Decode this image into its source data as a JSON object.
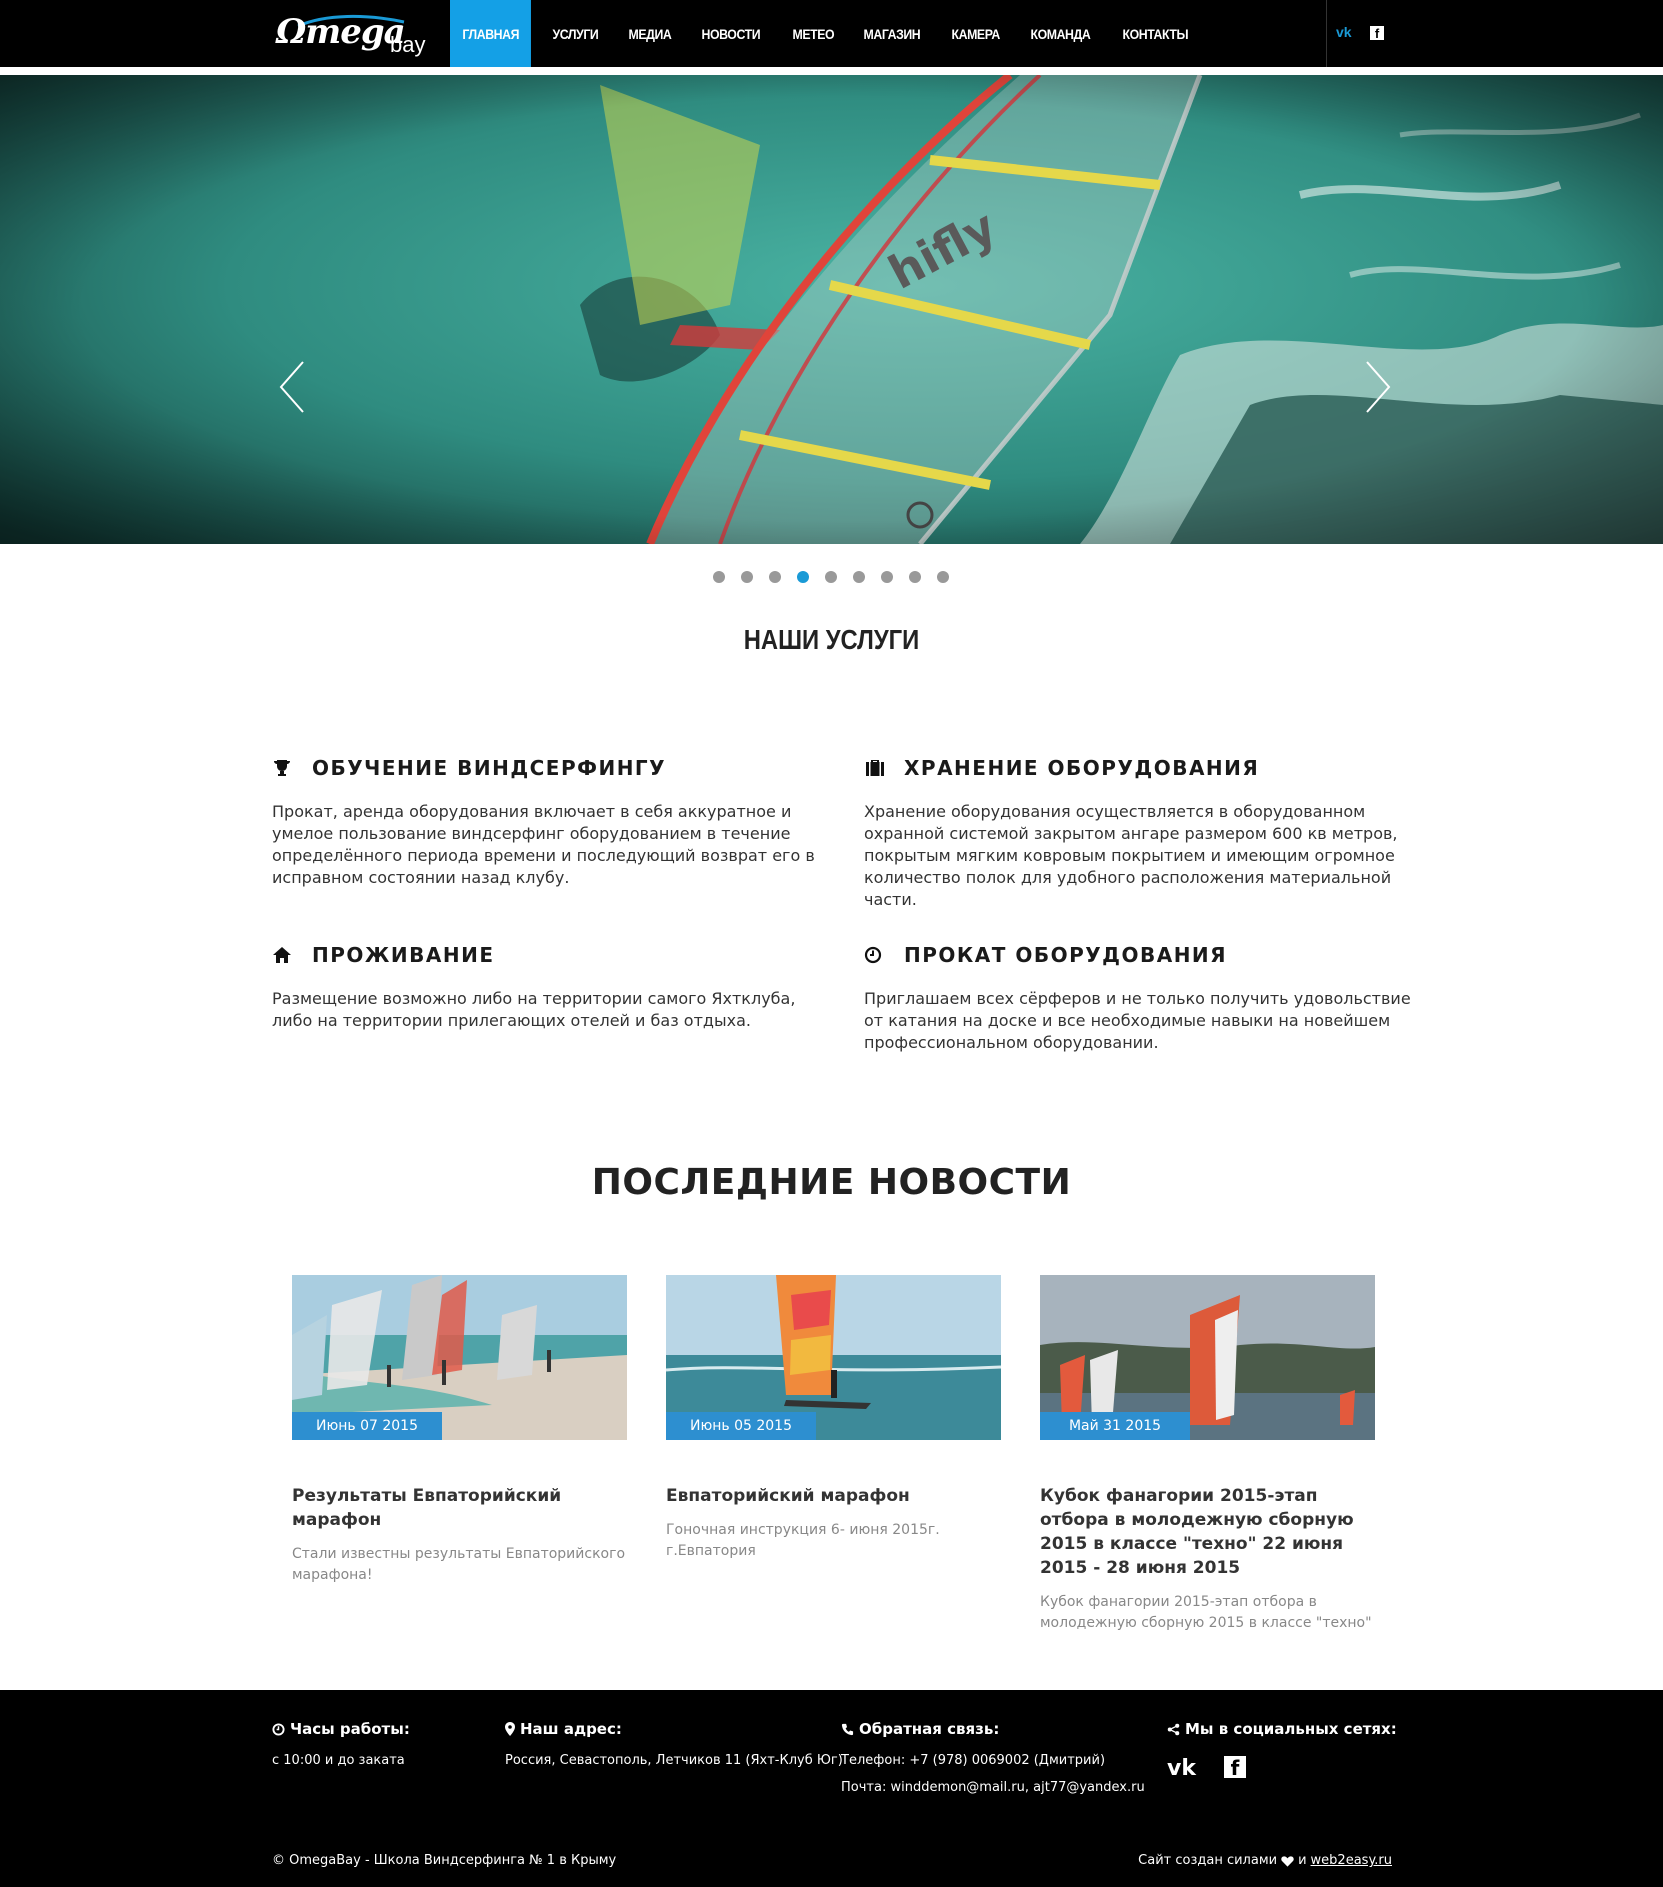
{
  "header": {
    "logo_main": "Ωmega",
    "logo_sub": "bay",
    "nav": [
      "ГЛАВНАЯ",
      "УСЛУГИ",
      "МЕДИА",
      "НОВОСТИ",
      "МЕТЕО",
      "МАГАЗИН",
      "КАМЕРА",
      "КОМАНДА",
      "КОНТАКТЫ"
    ],
    "active_index": 0,
    "social_vk": "vk",
    "social_fb": "f"
  },
  "slider": {
    "total_slides": 9,
    "active_slide": 4,
    "sail_text": "hifly"
  },
  "services": {
    "title": "НАШИ УСЛУГИ",
    "items": [
      {
        "icon": "trophy-icon",
        "title": "ОБУЧЕНИЕ ВИНДСЕРФИНГУ",
        "text": "Прокат, аренда оборудования включает в себя аккуратное и умелое пользование виндсерфинг оборудованием в течение определённого периода времени и последующий возврат его в исправном состоянии назад клубу."
      },
      {
        "icon": "suitcase-icon",
        "title": "ХРАНЕНИЕ ОБОРУДОВАНИЯ",
        "text": "Хранение оборудования осуществляется в оборудованном охранной системой закрытом ангаре размером 600 кв метров, покрытым мягким ковровым покрытием и имеющим огромное количество полок для удобного расположения материальной части."
      },
      {
        "icon": "home-icon",
        "title": "ПРОЖИВАНИЕ",
        "text": "Размещение возможно либо на территории самого Яхтклуба, либо на территории прилегающих отелей и баз отдыха."
      },
      {
        "icon": "clock-icon",
        "title": "ПРОКАТ ОБОРУДОВАНИЯ",
        "text": "Приглашаем всех сёрферов и не только получить удовольствие от катания на доске и все необходимые навыки на новейшем профессиональном оборудовании."
      }
    ]
  },
  "news": {
    "title": "ПОСЛЕДНИЕ НОВОСТИ",
    "items": [
      {
        "date": "Июнь 07 2015",
        "title": "Результаты Евпаторийский марафон",
        "text": "Стали известны результаты Евпаторийского марафона!"
      },
      {
        "date": "Июнь 05 2015",
        "title": "Евпаторийский марафон",
        "text": "Гоночная инструкция 6- июня 2015г. г.Евпатория"
      },
      {
        "date": "Май 31 2015",
        "title": "Кубок фанагории 2015-этап отбора в молодежную сборную 2015 в классе \"техно\" 22 июня 2015 - 28 июня 2015",
        "text": "Кубок фанагории 2015-этап отбора в молодежную сборную 2015 в классе \"техно\""
      }
    ]
  },
  "footer": {
    "hours_title": "Часы работы:",
    "hours_value": "с 10:00 и до заката",
    "address_title": "Наш адрес:",
    "address_value": "Россия, Севастополь, Летчиков 11 (Яхт-Клуб Юг)",
    "contact_title": "Обратная связь:",
    "phone": "Телефон: +7 (978) 0069002 (Дмитрий)",
    "email": "Почта: winddemon@mail.ru, ajt77@yandex.ru",
    "social_title": "Мы в социальных сетях:",
    "social_vk": "vk",
    "social_fb": "f",
    "copyright": "© OmegaBay - Школа Виндсерфинга № 1 в Крыму",
    "made_by_prefix": "Сайт создан силами",
    "made_by_and": "и",
    "made_by_link": "web2easy.ru"
  },
  "colors": {
    "accent": "#14a0e6",
    "date_badge": "#2d8fd0",
    "header_bg": "#000000",
    "footer_bg": "#000000"
  }
}
